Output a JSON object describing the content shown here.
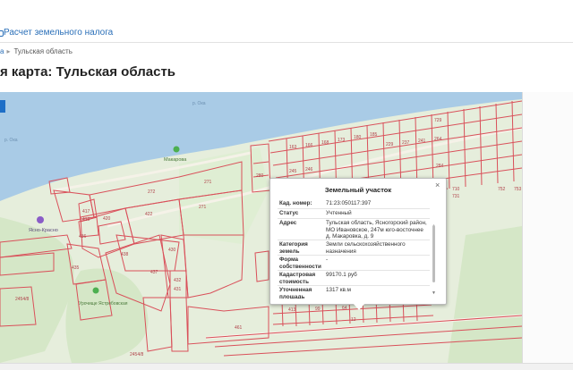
{
  "header": {
    "nav_link": "Расчет земельного налога"
  },
  "breadcrumb": {
    "parent": "а",
    "current": "Тульская область"
  },
  "page_title": "я карта: Тульская область",
  "map": {
    "river_labels": [
      "р. Ока",
      "р. Ока"
    ],
    "places": [
      {
        "label": "Макарова"
      },
      {
        "label": "Ясно-Красно"
      },
      {
        "label": "Урочище Ястребовская"
      }
    ],
    "parcel_numbers": [
      "272",
      "271",
      "271",
      "417",
      "419",
      "420",
      "436",
      "422",
      "438",
      "435",
      "430",
      "437",
      "432",
      "431",
      "10",
      "2454/8",
      "2454/8",
      "461",
      "280",
      "229",
      "237",
      "241",
      "264",
      "284",
      "710",
      "729",
      "731",
      "752",
      "753",
      "245",
      "246",
      "247",
      "248",
      "249",
      "250",
      "239",
      "256",
      "715",
      "720",
      "756",
      "735",
      "736",
      "746",
      "729",
      "748",
      "181",
      "163",
      "166",
      "168",
      "173",
      "180",
      "185",
      "137",
      "149",
      "156",
      "159",
      "157",
      "140",
      "413",
      "415",
      "413",
      "99",
      "64",
      "12",
      "10"
    ]
  },
  "popup": {
    "title": "Земельный участок",
    "rows": [
      {
        "label": "Кад. номер:",
        "value": "71:23:050117:397"
      },
      {
        "label": "Статус",
        "value": "Учтенный"
      },
      {
        "label": "Адрес",
        "value": "Тульская область, Ясногорский район, МО Ивановское, 247м юго-восточнее д. Макаровка, д. 9"
      },
      {
        "label": "Категория земель",
        "value": "Земли сельскохозяйственного назначения"
      },
      {
        "label": "Форма собственности",
        "value": "-"
      },
      {
        "label": "Кадастровая стоимость",
        "value": "99170.1 руб"
      },
      {
        "label": "Уточненная площадь",
        "value": "1317 кв.м"
      }
    ]
  },
  "colors": {
    "link": "#2a6fb8",
    "water": "#a9cbe6",
    "land": "#e6eedc",
    "parcel_line": "#d9505a",
    "accent": "#1e6fc7"
  }
}
